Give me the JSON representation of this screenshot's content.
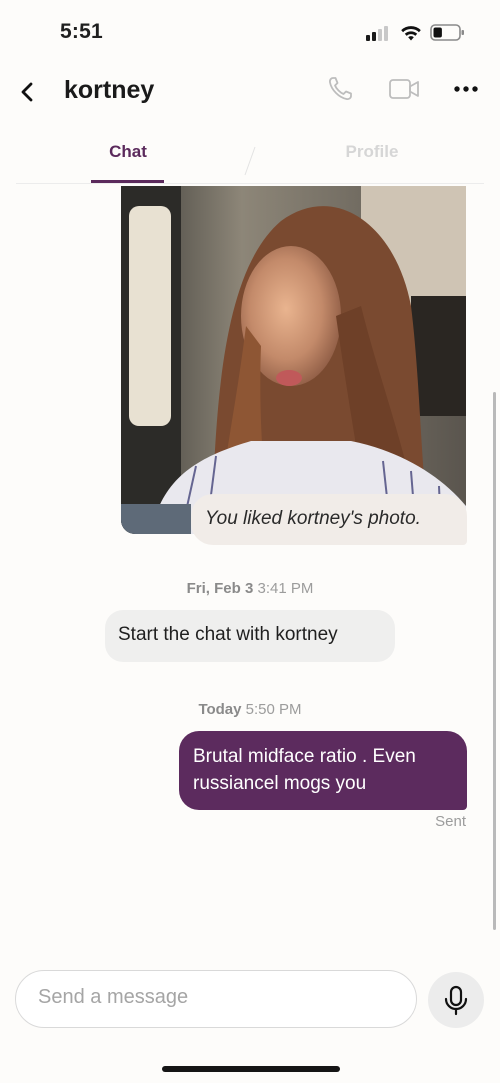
{
  "status_bar": {
    "time": "5:51",
    "signal_icon": "cellular-signal-icon",
    "wifi_icon": "wifi-icon",
    "battery_icon": "battery-icon",
    "battery_level": 0.35
  },
  "header": {
    "back_icon": "chevron-left-icon",
    "contact_name": "kortney",
    "actions": [
      "phone-icon",
      "video-camera-icon",
      "more-icon"
    ]
  },
  "tabs": [
    {
      "label": "Chat",
      "active": true
    },
    {
      "label": "Profile",
      "active": false
    }
  ],
  "colors": {
    "accent": "#5c2b5e",
    "background": "#fdfcfa",
    "incoming_bubble": "#efefee",
    "liked_bubble": "#f1ece8"
  },
  "messages": {
    "photo_reaction": "You liked kortney's photo.",
    "first_timestamp": {
      "day": "Fri, Feb 3",
      "time": "3:41 PM"
    },
    "system_message": "Start the chat with kortney",
    "second_timestamp": {
      "day": "Today",
      "time": "5:50 PM"
    },
    "outgoing_line1": "Brutal midface ratio . Even",
    "outgoing_line2": "russiancel mogs you",
    "status": "Sent"
  },
  "composer": {
    "placeholder": "Send a message",
    "mic_icon": "microphone-icon"
  }
}
